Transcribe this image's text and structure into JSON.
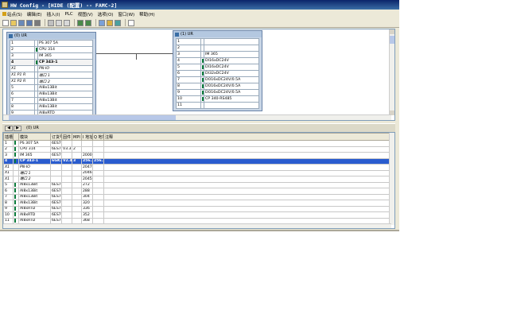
{
  "window": {
    "title": "HW Config - [HIDE (配置) -- FAMC-2]"
  },
  "menu": [
    {
      "label": "站点(S)",
      "icon": "station-icon"
    },
    {
      "label": "编辑(E)",
      "icon": "edit-icon"
    },
    {
      "label": "插入(I)",
      "icon": "insert-icon"
    },
    {
      "label": "PLC",
      "icon": "plc-icon"
    },
    {
      "label": "视图(V)",
      "icon": "view-icon"
    },
    {
      "label": "选项(O)",
      "icon": "options-icon"
    },
    {
      "label": "窗口(W)",
      "icon": "window-icon"
    },
    {
      "label": "帮助(H)",
      "icon": "help-icon"
    }
  ],
  "colors": {
    "titlebar": "#0a246a",
    "selection": "#2a5ccf",
    "rack_bg": "#c9d6e6",
    "module_marker": "#0a7a3a"
  },
  "rack_left": {
    "title": "(0) UR",
    "rows": [
      {
        "slot": "1",
        "module": "PS 307 5A",
        "marker": false,
        "selected": false,
        "italic": false
      },
      {
        "slot": "2",
        "module": "CPU 314",
        "marker": true,
        "selected": false,
        "italic": false
      },
      {
        "slot": "3",
        "module": "IM 365",
        "marker": false,
        "selected": false,
        "italic": false
      },
      {
        "slot": "4",
        "module": "CP 343-1",
        "marker": true,
        "selected": true,
        "italic": false
      },
      {
        "slot": "X1",
        "module": "PN-IO",
        "marker": false,
        "selected": false,
        "italic": true
      },
      {
        "slot": "X1 P1 R",
        "module": "端口 1",
        "marker": false,
        "selected": false,
        "italic": true
      },
      {
        "slot": "X1 P2 R",
        "module": "端口 2",
        "marker": false,
        "selected": false,
        "italic": true
      },
      {
        "slot": "5",
        "module": "AI8x13Bit",
        "marker": false,
        "selected": false,
        "italic": false
      },
      {
        "slot": "6",
        "module": "AI8x13Bit",
        "marker": false,
        "selected": false,
        "italic": false
      },
      {
        "slot": "7",
        "module": "AI8x13Bit",
        "marker": false,
        "selected": false,
        "italic": false
      },
      {
        "slot": "8",
        "module": "AI8x13Bit",
        "marker": false,
        "selected": false,
        "italic": false
      },
      {
        "slot": "9",
        "module": "AI8xRTD",
        "marker": false,
        "selected": false,
        "italic": false
      },
      {
        "slot": "10",
        "module": "AI8xRTD",
        "marker": false,
        "selected": false,
        "italic": false
      },
      {
        "slot": "11",
        "module": "AI8xRTD",
        "marker": false,
        "selected": false,
        "italic": false
      }
    ]
  },
  "rack_right": {
    "title": "(1) UR",
    "rows": [
      {
        "slot": "1",
        "module": "",
        "marker": false
      },
      {
        "slot": "2",
        "module": "",
        "marker": false
      },
      {
        "slot": "3",
        "module": "IM 365",
        "marker": false
      },
      {
        "slot": "4",
        "module": "DI16xDC24V",
        "marker": true
      },
      {
        "slot": "5",
        "module": "DI16xDC24V",
        "marker": true
      },
      {
        "slot": "6",
        "module": "DI32xDC24V",
        "marker": true
      },
      {
        "slot": "7",
        "module": "DO16xDC24V/0.5A",
        "marker": true
      },
      {
        "slot": "8",
        "module": "DO16xDC24V/0.5A",
        "marker": true
      },
      {
        "slot": "9",
        "module": "DO16xDC24V/0.5A",
        "marker": true
      },
      {
        "slot": "10",
        "module": "CP 340-RS485",
        "marker": true
      },
      {
        "slot": "11",
        "module": "",
        "marker": false
      }
    ]
  },
  "detail": {
    "title": "(0) UR",
    "columns": [
      "插槽",
      "",
      "模块",
      "订货号",
      "固件",
      "MPI 地址",
      "I 地址",
      "Q 地址",
      "注释"
    ],
    "rows": [
      {
        "slot": "1",
        "module": "PS 307 5A",
        "order": "6ES7",
        "fw": "",
        "mpi": "",
        "i": "",
        "q": "",
        "marker": true,
        "selected": false,
        "italic": false
      },
      {
        "slot": "2",
        "module": "CPU 314",
        "order": "6ES7",
        "fw": "V3.3",
        "mpi": "2",
        "i": "",
        "q": "",
        "marker": true,
        "selected": false,
        "italic": false
      },
      {
        "slot": "3",
        "module": "IM 365",
        "order": "6ES7",
        "fw": "",
        "mpi": "",
        "i": "2000",
        "q": "",
        "marker": true,
        "selected": false,
        "italic": false
      },
      {
        "slot": "4",
        "module": "CP 343-1",
        "order": "6GK7",
        "fw": "V2.4",
        "mpi": "3",
        "i": "256...",
        "q": "256...",
        "marker": true,
        "selected": true,
        "italic": false
      },
      {
        "slot": "X1",
        "module": "PN-IO",
        "order": "",
        "fw": "",
        "mpi": "",
        "i": "2047*",
        "q": "",
        "marker": false,
        "selected": false,
        "italic": true
      },
      {
        "slot": "X1",
        "module": "端口 1",
        "order": "",
        "fw": "",
        "mpi": "",
        "i": "2046*",
        "q": "",
        "marker": false,
        "selected": false,
        "italic": true
      },
      {
        "slot": "X1",
        "module": "端口 2",
        "order": "",
        "fw": "",
        "mpi": "",
        "i": "2045*",
        "q": "",
        "marker": false,
        "selected": false,
        "italic": true
      },
      {
        "slot": "5",
        "module": "AI8x13Bit",
        "order": "6ES7",
        "fw": "",
        "mpi": "",
        "i": "272",
        "q": "",
        "marker": true,
        "selected": false,
        "italic": false
      },
      {
        "slot": "6",
        "module": "AI8x13Bit",
        "order": "6ES7",
        "fw": "",
        "mpi": "",
        "i": "288",
        "q": "",
        "marker": true,
        "selected": false,
        "italic": false
      },
      {
        "slot": "7",
        "module": "AI8x13Bit",
        "order": "6ES7",
        "fw": "",
        "mpi": "",
        "i": "304",
        "q": "",
        "marker": true,
        "selected": false,
        "italic": false
      },
      {
        "slot": "8",
        "module": "AI8x13Bit",
        "order": "6ES7",
        "fw": "",
        "mpi": "",
        "i": "320",
        "q": "",
        "marker": true,
        "selected": false,
        "italic": false
      },
      {
        "slot": "9",
        "module": "AI8xRTD",
        "order": "6ES7",
        "fw": "",
        "mpi": "",
        "i": "336",
        "q": "",
        "marker": true,
        "selected": false,
        "italic": false
      },
      {
        "slot": "10",
        "module": "AI8xRTD",
        "order": "6ES7",
        "fw": "",
        "mpi": "",
        "i": "352",
        "q": "",
        "marker": true,
        "selected": false,
        "italic": false
      },
      {
        "slot": "11",
        "module": "AI8xRTD",
        "order": "6ES7",
        "fw": "",
        "mpi": "",
        "i": "368",
        "q": "",
        "marker": true,
        "selected": false,
        "italic": false
      }
    ]
  },
  "toolbar": {
    "buttons": [
      "new-icon",
      "open-icon",
      "save-compile-icon",
      "save-icon",
      "print-icon",
      "cut-icon",
      "copy-icon",
      "paste-icon",
      "download-icon",
      "upload-icon",
      "catalog-icon",
      "overview-icon",
      "network-icon",
      "help-context-icon"
    ]
  }
}
